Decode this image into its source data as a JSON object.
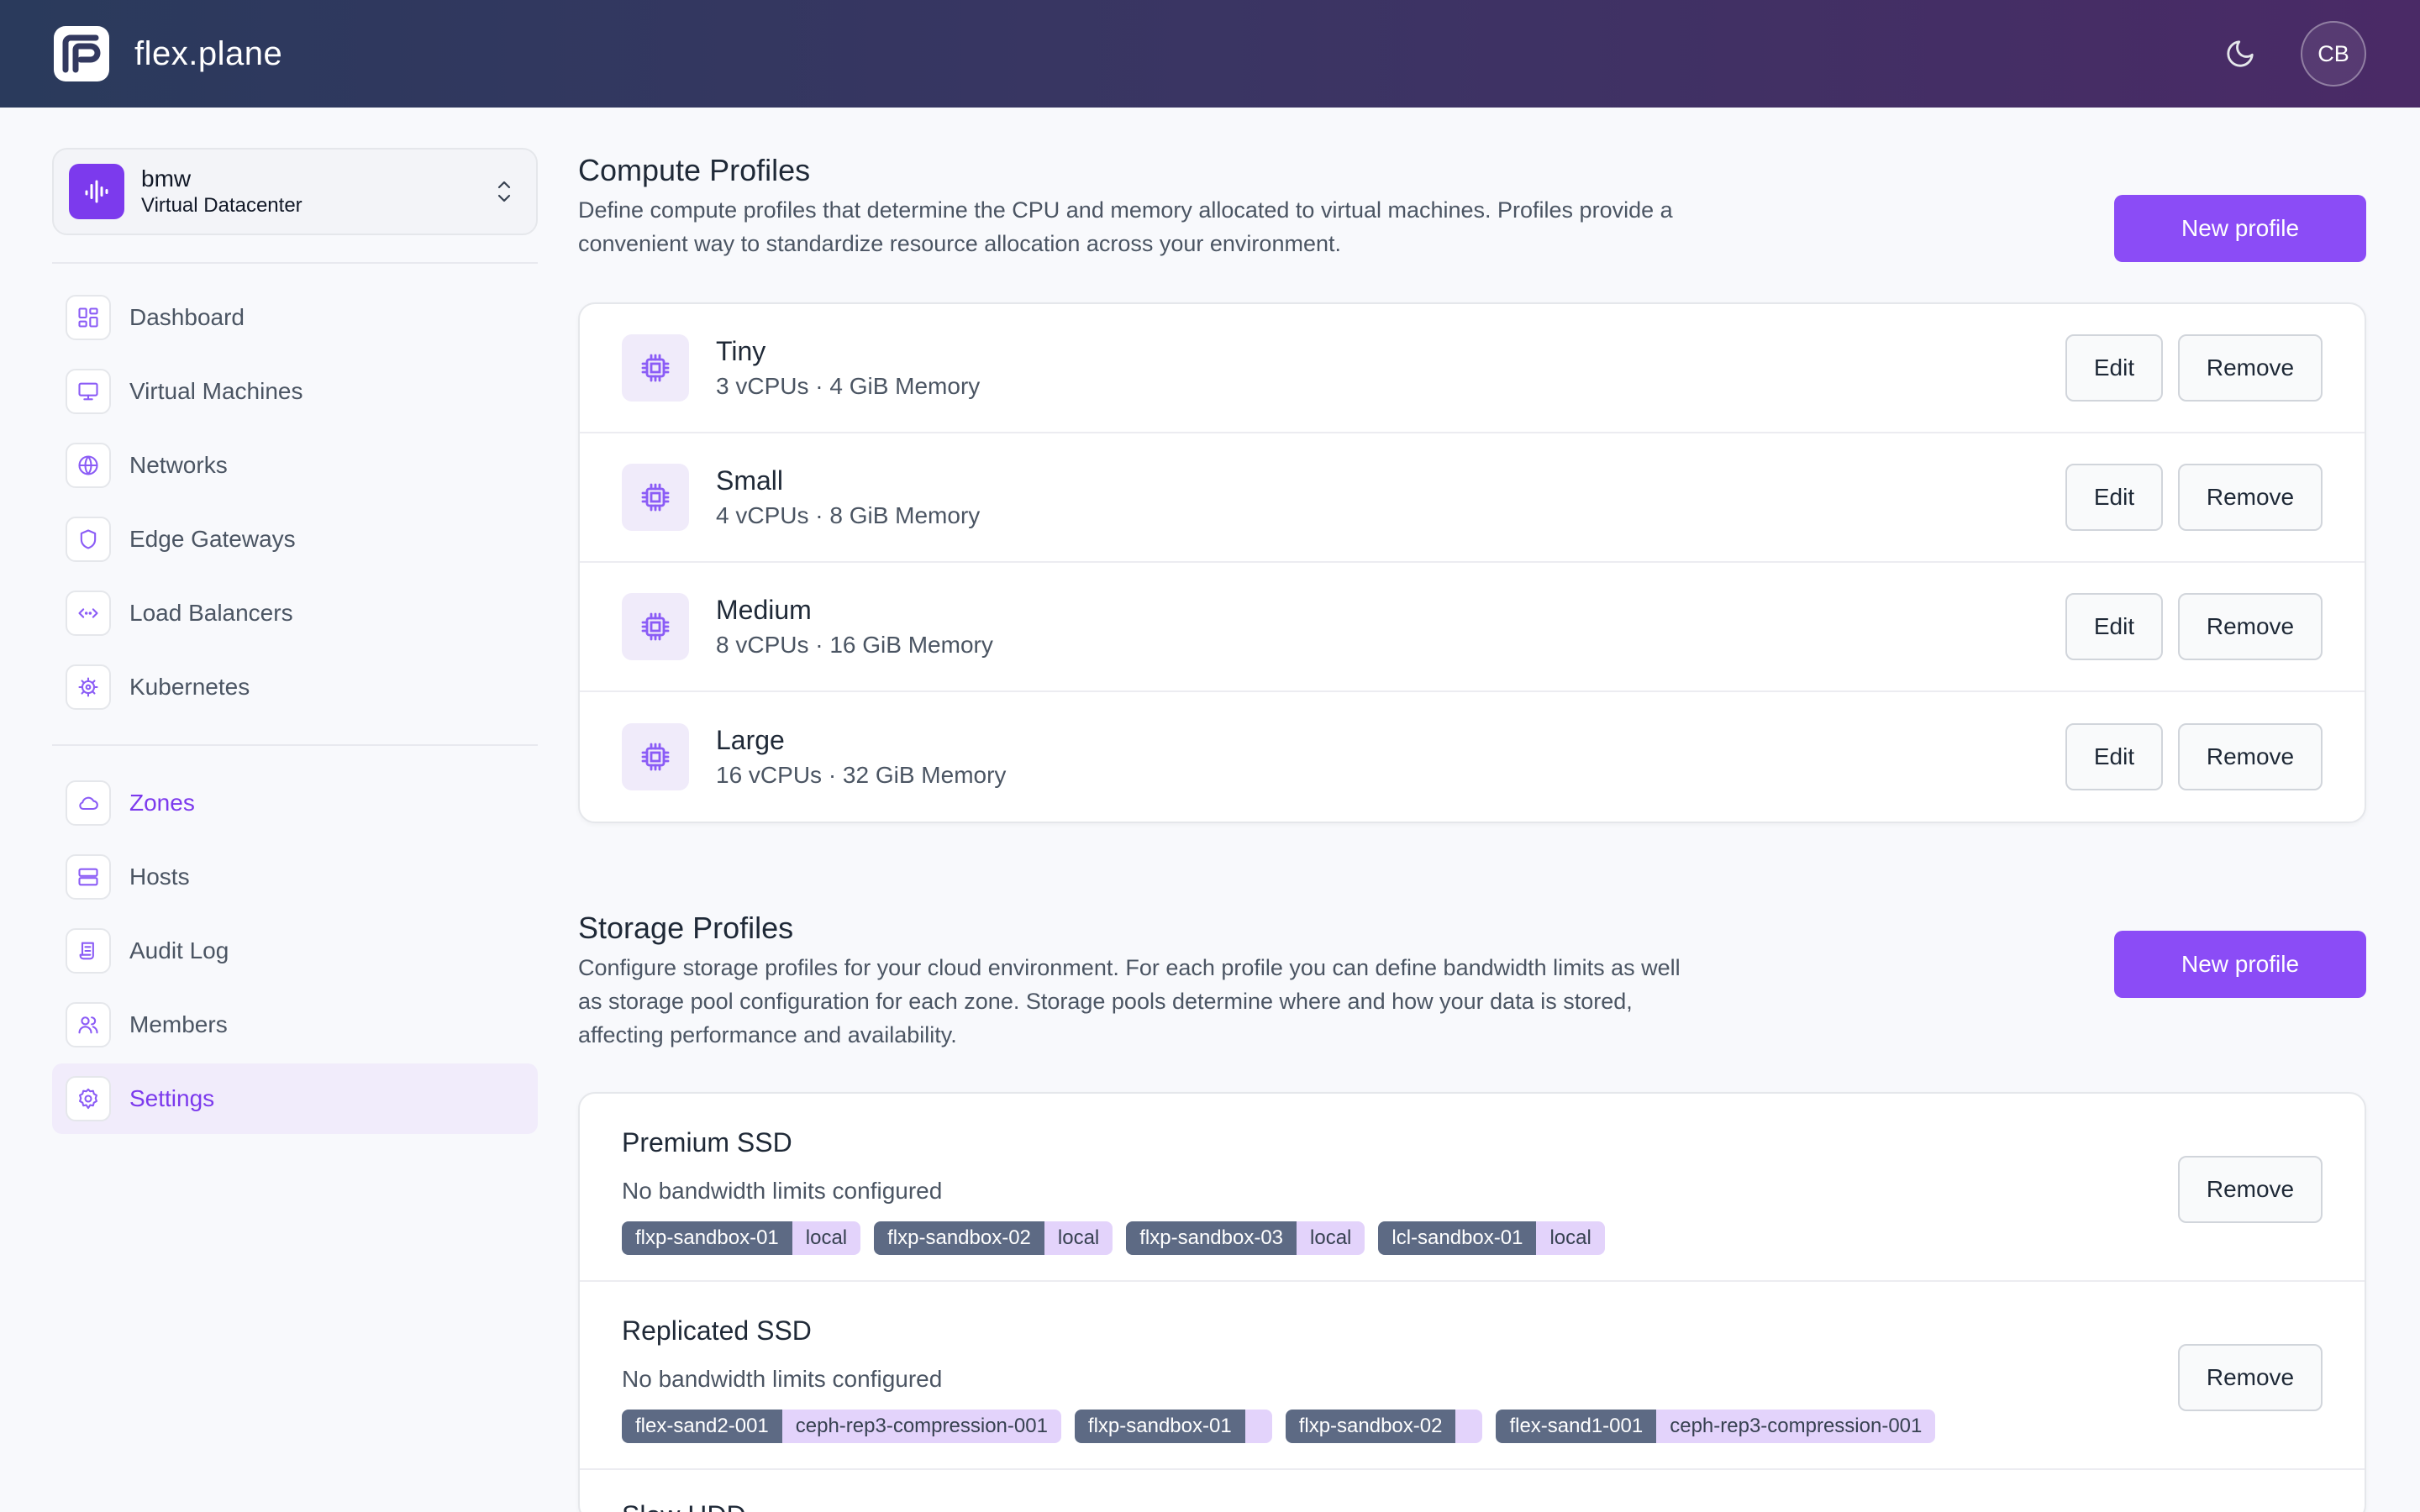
{
  "header": {
    "brand": "flex.plane",
    "avatar_initials": "CB"
  },
  "datacenter": {
    "name": "bmw",
    "type": "Virtual Datacenter"
  },
  "nav": {
    "primary": [
      {
        "label": "Dashboard",
        "icon": "dashboard-icon"
      },
      {
        "label": "Virtual Machines",
        "icon": "monitor-icon"
      },
      {
        "label": "Networks",
        "icon": "globe-icon"
      },
      {
        "label": "Edge Gateways",
        "icon": "shield-icon"
      },
      {
        "label": "Load Balancers",
        "icon": "code-arrows-icon"
      },
      {
        "label": "Kubernetes",
        "icon": "helm-icon"
      }
    ],
    "secondary": [
      {
        "label": "Zones",
        "icon": "cloud-icon"
      },
      {
        "label": "Hosts",
        "icon": "server-icon"
      },
      {
        "label": "Audit Log",
        "icon": "scroll-icon"
      },
      {
        "label": "Members",
        "icon": "users-icon"
      },
      {
        "label": "Settings",
        "icon": "gear-icon"
      }
    ]
  },
  "compute": {
    "title": "Compute Profiles",
    "description": "Define compute profiles that determine the CPU and memory allocated to virtual machines. Profiles provide a convenient way to standardize resource allocation across your environment.",
    "new_label": "New profile",
    "edit_label": "Edit",
    "remove_label": "Remove",
    "profiles": [
      {
        "name": "Tiny",
        "spec": "3 vCPUs · 4 GiB Memory"
      },
      {
        "name": "Small",
        "spec": "4 vCPUs · 8 GiB Memory"
      },
      {
        "name": "Medium",
        "spec": "8 vCPUs · 16 GiB Memory"
      },
      {
        "name": "Large",
        "spec": "16 vCPUs · 32 GiB Memory"
      }
    ]
  },
  "storage": {
    "title": "Storage Profiles",
    "description": "Configure storage profiles for your cloud environment. For each profile you can define bandwidth limits as well as storage pool configuration for each zone. Storage pools determine where and how your data is stored, affecting performance and availability.",
    "new_label": "New profile",
    "remove_label": "Remove",
    "profiles": [
      {
        "name": "Premium SSD",
        "limits": "No bandwidth limits configured",
        "tags": [
          {
            "host": "flxp-sandbox-01",
            "pool": "local"
          },
          {
            "host": "flxp-sandbox-02",
            "pool": "local"
          },
          {
            "host": "flxp-sandbox-03",
            "pool": "local"
          },
          {
            "host": "lcl-sandbox-01",
            "pool": "local"
          }
        ]
      },
      {
        "name": "Replicated SSD",
        "limits": "No bandwidth limits configured",
        "tags": [
          {
            "host": "flex-sand2-001",
            "pool": "ceph-rep3-compression-001"
          },
          {
            "host": "flxp-sandbox-01",
            "pool": ""
          },
          {
            "host": "flxp-sandbox-02",
            "pool": ""
          },
          {
            "host": "flex-sand1-001",
            "pool": "ceph-rep3-compression-001"
          }
        ]
      }
    ],
    "partial_next": "Slow HDD"
  },
  "colors": {
    "accent": "#8b4cf6",
    "header_from": "#2a3a5c",
    "header_to": "#4a2a66",
    "tag_host": "#5d6a84",
    "tag_pool": "#e3d3fb"
  }
}
